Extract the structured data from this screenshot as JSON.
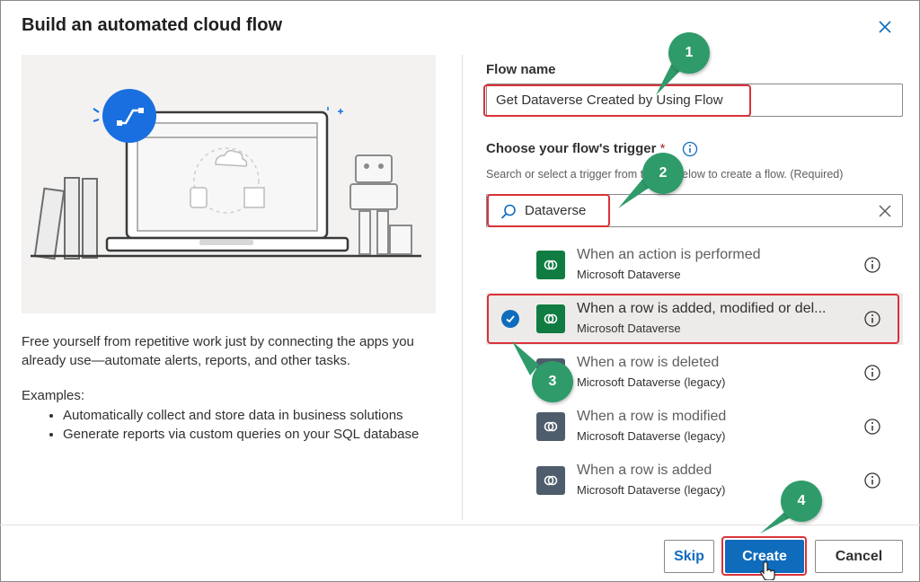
{
  "dialog": {
    "title": "Build an automated cloud flow",
    "close_icon": "close-icon"
  },
  "left": {
    "description": "Free yourself from repetitive work just by connecting the apps you already use—automate alerts, reports, and other tasks.",
    "examples_title": "Examples:",
    "examples": [
      "Automatically collect and store data in business solutions",
      "Generate reports via custom queries on your SQL database"
    ]
  },
  "form": {
    "flow_name_label": "Flow name",
    "flow_name_value": "Get Dataverse Created by Using Flow",
    "trigger_label": "Choose your flow's trigger",
    "required_mark": "*",
    "trigger_hint": "Search or select a trigger from the list below to create a flow. (Required)",
    "search_value": "Dataverse"
  },
  "triggers": [
    {
      "title": "When an action is performed",
      "subtitle": "Microsoft Dataverse",
      "color": "#107c41",
      "selected": false
    },
    {
      "title": "When a row is added, modified or del...",
      "subtitle": "Microsoft Dataverse",
      "color": "#107c41",
      "selected": true
    },
    {
      "title": "When a row is deleted",
      "subtitle": "Microsoft Dataverse (legacy)",
      "color": "#4e5d6c",
      "selected": false
    },
    {
      "title": "When a row is modified",
      "subtitle": "Microsoft Dataverse (legacy)",
      "color": "#4e5d6c",
      "selected": false
    },
    {
      "title": "When a row is added",
      "subtitle": "Microsoft Dataverse (legacy)",
      "color": "#4e5d6c",
      "selected": false
    }
  ],
  "footer": {
    "skip_label": "Skip",
    "create_label": "Create",
    "cancel_label": "Cancel"
  },
  "callouts": [
    "1",
    "2",
    "3",
    "4"
  ],
  "colors": {
    "accent": "#0f6cbd",
    "highlight_red": "#d9323a",
    "callout_green": "#2f9b6a",
    "dataverse_green": "#107c41",
    "legacy_gray": "#4e5d6c"
  }
}
